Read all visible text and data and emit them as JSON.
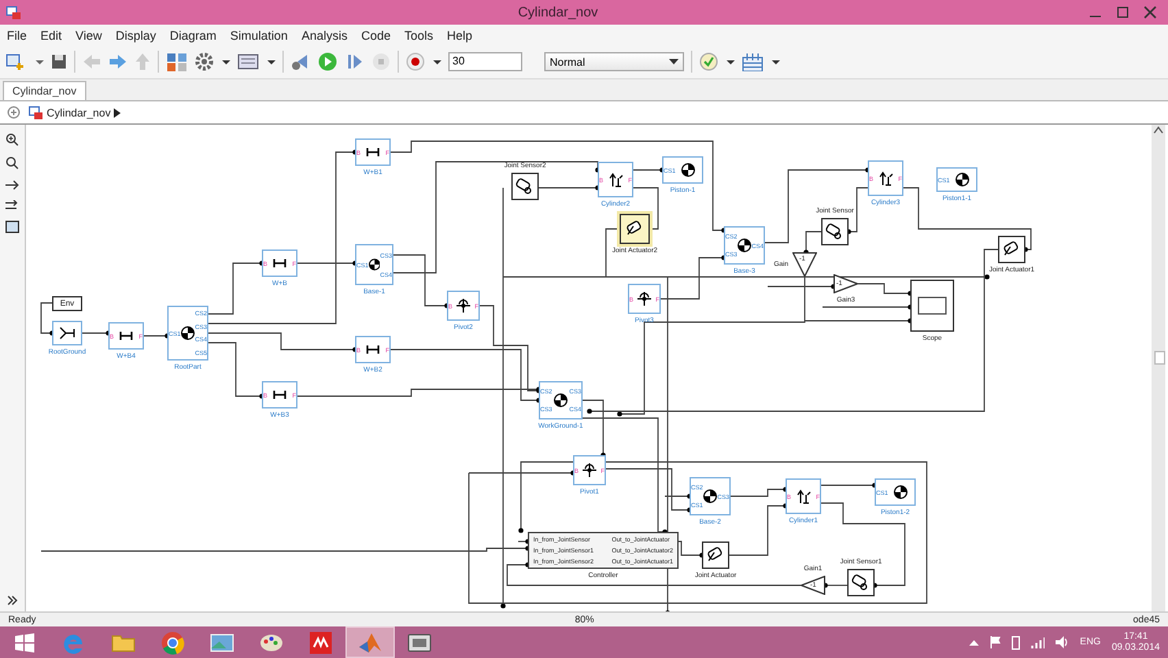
{
  "window": {
    "title": "Cylindar_nov"
  },
  "menu": [
    "File",
    "Edit",
    "View",
    "Display",
    "Diagram",
    "Simulation",
    "Analysis",
    "Code",
    "Tools",
    "Help"
  ],
  "toolbar": {
    "stop_time": "30",
    "sim_mode": "Normal"
  },
  "tabs": [
    {
      "label": "Cylindar_nov",
      "selected": true
    }
  ],
  "breadcrumb": "Cylindar_nov",
  "diagram": {
    "blocks": [
      {
        "kind": "env",
        "label": "Env",
        "selected": false
      },
      {
        "kind": "ground",
        "label": "RootGround",
        "selected": false
      },
      {
        "kind": "weld",
        "label": "W+B4",
        "selected": false,
        "ports_left": [
          "B"
        ],
        "ports_right": [
          "F"
        ]
      },
      {
        "kind": "body",
        "label": "RootPart",
        "selected": false,
        "ports_left": [
          "CS1"
        ],
        "ports_right": [
          "CS2",
          "CS3",
          "CS4",
          "CS5"
        ]
      },
      {
        "kind": "weld",
        "label": "W+B",
        "selected": false,
        "ports_left": [
          "B"
        ],
        "ports_right": [
          "F"
        ]
      },
      {
        "kind": "weld",
        "label": "W+B1",
        "selected": false,
        "ports_left": [
          "B"
        ],
        "ports_right": [
          "F"
        ]
      },
      {
        "kind": "body",
        "label": "Base-1",
        "selected": false,
        "ports_left": [
          "CS1"
        ],
        "ports_right": [
          "CS3",
          "CS4"
        ]
      },
      {
        "kind": "weld",
        "label": "W+B2",
        "selected": false,
        "ports_left": [
          "B"
        ],
        "ports_right": [
          "F"
        ]
      },
      {
        "kind": "weld",
        "label": "W+B3",
        "selected": false,
        "ports_left": [
          "B"
        ],
        "ports_right": [
          "F"
        ]
      },
      {
        "kind": "pivot",
        "label": "Pivot2",
        "selected": false,
        "ports_left": [
          "B"
        ],
        "ports_right": [
          "F"
        ]
      },
      {
        "kind": "sensor",
        "label": "Joint Sensor2",
        "selected": false
      },
      {
        "kind": "cylinder",
        "label": "Cylinder2",
        "selected": false,
        "ports_left": [
          "B"
        ],
        "ports_right": [
          "F"
        ]
      },
      {
        "kind": "body",
        "label": "Piston-1",
        "selected": false,
        "ports_left": [
          "CS1"
        ]
      },
      {
        "kind": "actuator",
        "label": "Joint Actuator2",
        "selected": true
      },
      {
        "kind": "body",
        "label": "Base-3",
        "selected": false,
        "ports_left": [
          "CS2",
          "CS3"
        ],
        "ports_right": [
          "CS4"
        ]
      },
      {
        "kind": "pivot",
        "label": "Pivot3",
        "selected": false,
        "ports_left": [
          "B"
        ],
        "ports_right": [
          "F"
        ]
      },
      {
        "kind": "body",
        "label": "WorkGround-1",
        "selected": false,
        "ports_left": [
          "CS2",
          "CS3"
        ],
        "ports_right": [
          "CS3",
          "CS4"
        ]
      },
      {
        "kind": "cylinder",
        "label": "Cylinder3",
        "selected": false,
        "ports_left": [
          "B"
        ],
        "ports_right": [
          "F"
        ]
      },
      {
        "kind": "body",
        "label": "Piston1-1",
        "selected": false,
        "ports_left": [
          "CS1"
        ]
      },
      {
        "kind": "sensor",
        "label": "Joint Sensor",
        "selected": false
      },
      {
        "kind": "gain",
        "label": "Gain",
        "selected": false,
        "value": "-1"
      },
      {
        "kind": "gain",
        "label": "Gain3",
        "selected": false,
        "value": "-1"
      },
      {
        "kind": "scope",
        "label": "Scope",
        "selected": false
      },
      {
        "kind": "actuator",
        "label": "Joint Actuator1",
        "selected": false
      },
      {
        "kind": "pivot",
        "label": "Pivot1",
        "selected": false,
        "ports_left": [
          "B"
        ],
        "ports_right": [
          "F"
        ]
      },
      {
        "kind": "body",
        "label": "Base-2",
        "selected": false,
        "ports_left": [
          "CS2",
          "CS1"
        ],
        "ports_right": [
          "CS3"
        ]
      },
      {
        "kind": "cylinder",
        "label": "Cylinder1",
        "selected": false,
        "ports_left": [
          "B"
        ],
        "ports_right": [
          "F"
        ]
      },
      {
        "kind": "body",
        "label": "Piston1-2",
        "selected": false,
        "ports_left": [
          "CS1"
        ]
      },
      {
        "kind": "controller",
        "label": "Controller",
        "selected": false,
        "inputs": [
          "In_from_JointSensor",
          "In_from_JointSensor1",
          "In_from_JointSensor2"
        ],
        "outputs": [
          "Out_to_JointActuator",
          "Out_to_JointActuator2",
          "Out_to_JointActuator1"
        ]
      },
      {
        "kind": "actuator",
        "label": "Joint Actuator",
        "selected": false
      },
      {
        "kind": "gain",
        "label": "Gain1",
        "selected": false,
        "value": "-1"
      },
      {
        "kind": "sensor",
        "label": "Joint Sensor1",
        "selected": false
      }
    ]
  },
  "status_bar": {
    "status": "Ready",
    "zoom": "80%",
    "solver": "ode45"
  },
  "taskbar": {
    "apps": [
      {
        "kind": "browser",
        "active": false
      },
      {
        "kind": "folder",
        "active": false
      },
      {
        "kind": "chrome",
        "active": false
      },
      {
        "kind": "photos",
        "active": false
      },
      {
        "kind": "paint",
        "active": false
      },
      {
        "kind": "cad",
        "active": false
      },
      {
        "kind": "matlab",
        "active": true
      },
      {
        "kind": "video",
        "active": false
      }
    ],
    "language": "ENG",
    "time": "17:41",
    "date": "09.03.2014"
  }
}
